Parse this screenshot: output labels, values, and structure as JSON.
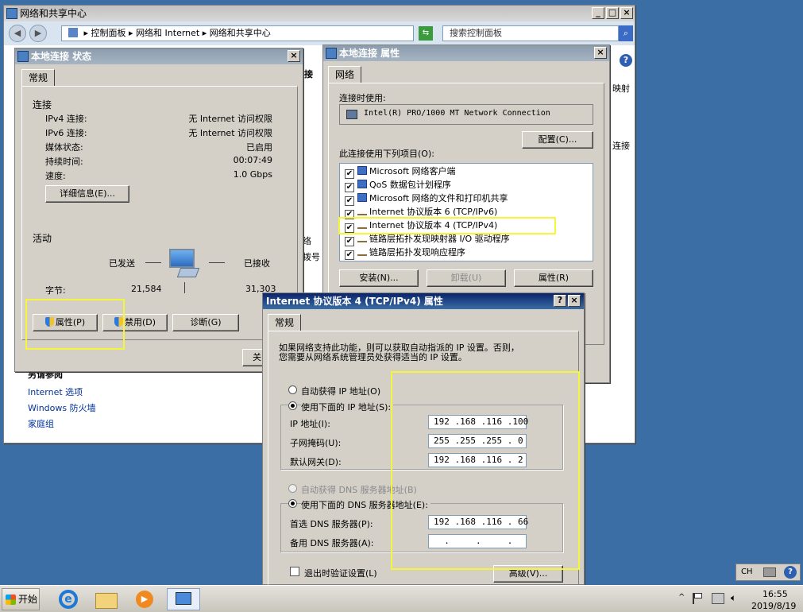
{
  "nsc_window": {
    "title": "网络和共享中心",
    "address": [
      "控制面板",
      "网络和 Internet",
      "网络和共享中心"
    ],
    "search_placeholder": "搜索控制面板",
    "behind_left_heading": "另请参阅",
    "behind_left_links": [
      "Internet 选项",
      "Windows 防火墙",
      "家庭组"
    ],
    "behind_text": [
      "接",
      "络",
      "拨号",
      "映射",
      "连接"
    ]
  },
  "status_dialog": {
    "title": "本地连接 状态",
    "tab": "常规",
    "connection_heading": "连接",
    "rows": [
      {
        "label": "IPv4 连接:",
        "value": "无 Internet 访问权限"
      },
      {
        "label": "IPv6 连接:",
        "value": "无 Internet 访问权限"
      },
      {
        "label": "媒体状态:",
        "value": "已启用"
      },
      {
        "label": "持续时间:",
        "value": "00:07:49"
      },
      {
        "label": "速度:",
        "value": "1.0 Gbps"
      }
    ],
    "details_button": "详细信息(E)...",
    "activity_heading": "活动",
    "sent_label": "已发送",
    "received_label": "已接收",
    "bytes_label": "字节:",
    "bytes_sent": "21,584",
    "bytes_received": "31,303",
    "properties_button": "属性(P)",
    "disable_button": "禁用(D)",
    "diagnose_button": "诊断(G)",
    "close_button": "关"
  },
  "props_dialog": {
    "title": "本地连接 属性",
    "tab": "网络",
    "connect_using_label": "连接时使用:",
    "adapter": "Intel(R) PRO/1000 MT Network Connection",
    "configure_button": "配置(C)...",
    "items_label": "此连接使用下列项目(O):",
    "items": [
      {
        "label": "Microsoft 网络客户端",
        "checked": true,
        "icon": "network-client-icon"
      },
      {
        "label": "QoS 数据包计划程序",
        "checked": true,
        "icon": "qos-icon"
      },
      {
        "label": "Microsoft 网络的文件和打印机共享",
        "checked": true,
        "icon": "file-share-icon"
      },
      {
        "label": "Internet 协议版本 6 (TCP/IPv6)",
        "checked": true,
        "icon": "protocol-icon"
      },
      {
        "label": "Internet 协议版本 4 (TCP/IPv4)",
        "checked": true,
        "icon": "protocol-icon"
      },
      {
        "label": "链路层拓扑发现映射器 I/O 驱动程序",
        "checked": true,
        "icon": "protocol-icon"
      },
      {
        "label": "链路层拓扑发现响应程序",
        "checked": true,
        "icon": "protocol-icon"
      }
    ],
    "install_button": "安装(N)...",
    "uninstall_button": "卸载(U)",
    "properties_button": "属性(R)"
  },
  "ipv4_dialog": {
    "title": "Internet 协议版本 4 (TCP/IPv4) 属性",
    "tab": "常规",
    "description": [
      "如果网络支持此功能，则可以获取自动指派的 IP 设置。否则，",
      "您需要从网络系统管理员处获得适当的 IP 设置。"
    ],
    "auto_ip": "自动获得 IP 地址(O)",
    "manual_ip": "使用下面的 IP 地址(S):",
    "ip_label": "IP 地址(I):",
    "ip_value": "192 .168 .116 .100",
    "mask_label": "子网掩码(U):",
    "mask_value": "255 .255 .255 . 0",
    "gateway_label": "默认网关(D):",
    "gateway_value": "192 .168 .116 . 2",
    "auto_dns": "自动获得 DNS 服务器地址(B)",
    "manual_dns": "使用下面的 DNS 服务器地址(E):",
    "dns1_label": "首选 DNS 服务器(P):",
    "dns1_value": "192 .168 .116 . 66",
    "dns2_label": "备用 DNS 服务器(A):",
    "dns2_value": "  .     .     .  ",
    "validate_label": "退出时验证设置(L)",
    "advanced_button": "高级(V)..."
  },
  "taskbar": {
    "start": "开始",
    "lang": "CH",
    "time": "16:55",
    "date": "2019/8/19"
  },
  "colors": {
    "highlight": "#f5f53a",
    "desktop": "#3a6ea5"
  }
}
